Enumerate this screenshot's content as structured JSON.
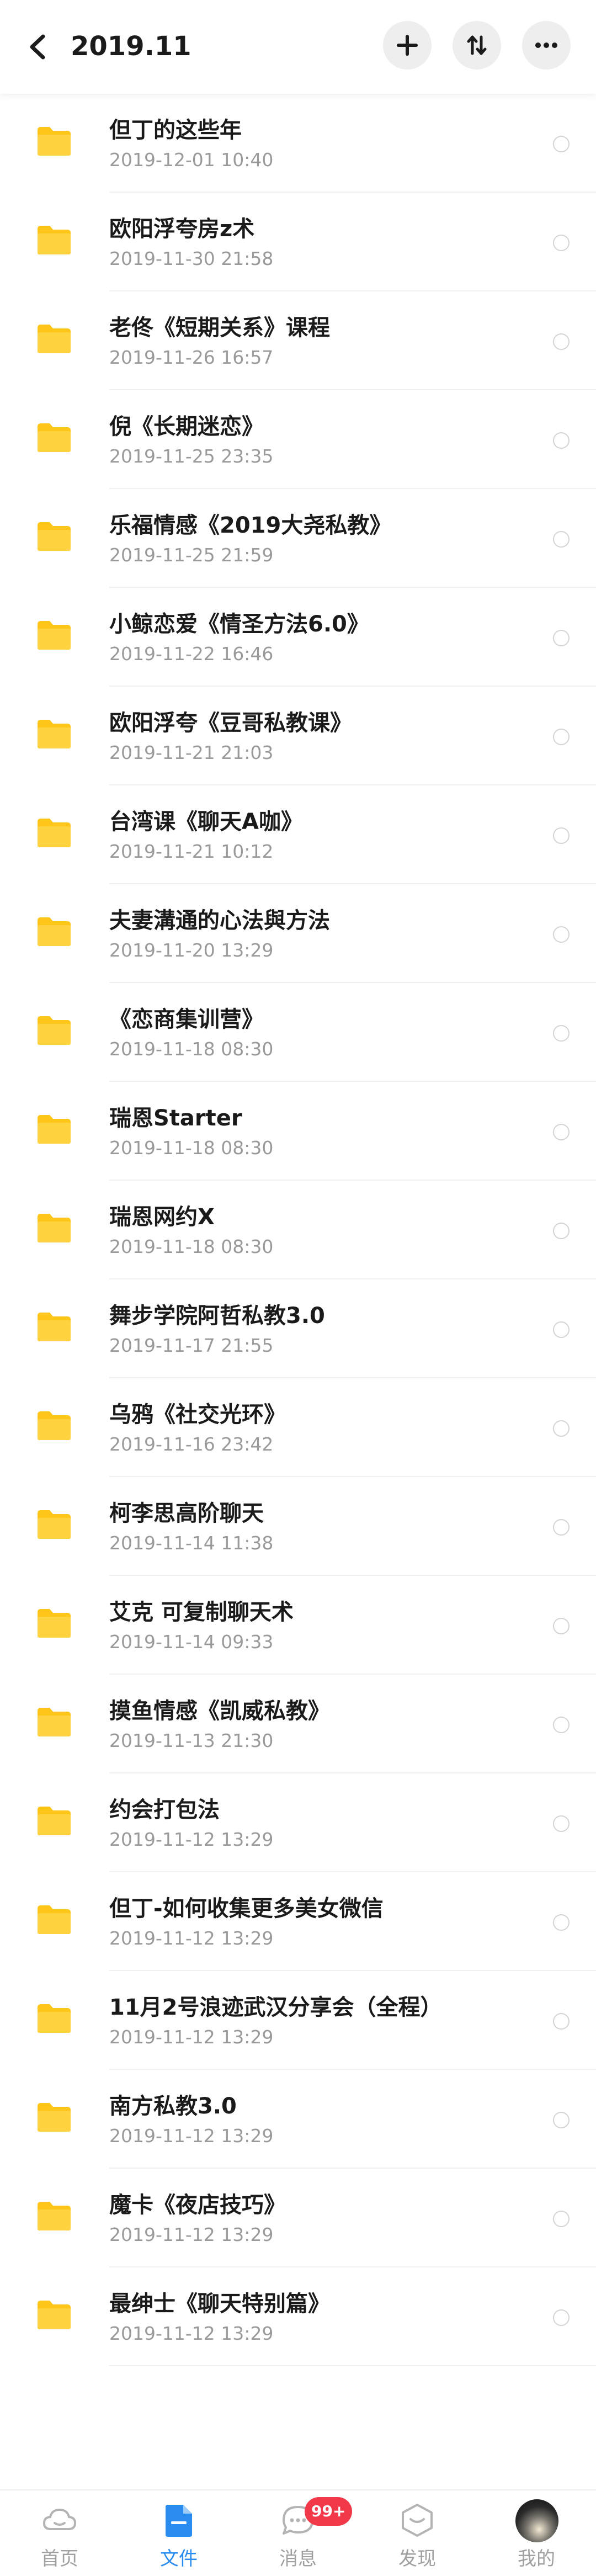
{
  "header": {
    "title": "2019.11",
    "back_icon": "chevron-left-icon",
    "actions": [
      "plus-icon",
      "sort-icon",
      "more-icon"
    ]
  },
  "colors": {
    "folder": "#FFC61A",
    "accent": "#2B8CF0",
    "badge": "#F2394A",
    "date": "#9A9A9A"
  },
  "folders": [
    {
      "name": "但丁的这些年",
      "date": "2019-12-01  10:40"
    },
    {
      "name": "欧阳浮夸房z术",
      "date": "2019-11-30  21:58"
    },
    {
      "name": "老佟《短期关系》课程",
      "date": "2019-11-26  16:57"
    },
    {
      "name": "倪《长期迷恋》",
      "date": "2019-11-25  23:35"
    },
    {
      "name": "乐福情感《2019大尧私教》",
      "date": "2019-11-25  21:59"
    },
    {
      "name": "小鲸恋爱《情圣方法6.0》",
      "date": "2019-11-22  16:46"
    },
    {
      "name": "欧阳浮夸《豆哥私教课》",
      "date": "2019-11-21  21:03"
    },
    {
      "name": "台湾课《聊天A咖》",
      "date": "2019-11-21  10:12"
    },
    {
      "name": "夫妻溝通的心法與方法",
      "date": "2019-11-20  13:29"
    },
    {
      "name": "《恋商集训营》",
      "date": "2019-11-18  08:30"
    },
    {
      "name": "瑞恩Starter",
      "date": "2019-11-18  08:30"
    },
    {
      "name": "瑞恩网约X",
      "date": "2019-11-18  08:30"
    },
    {
      "name": "舞步学院阿哲私教3.0",
      "date": "2019-11-17  21:55"
    },
    {
      "name": "乌鸦《社交光环》",
      "date": "2019-11-16  23:42"
    },
    {
      "name": "柯李思高阶聊天",
      "date": "2019-11-14  11:38"
    },
    {
      "name": "艾克 可复制聊天术",
      "date": "2019-11-14  09:33"
    },
    {
      "name": "摸鱼情感《凯威私教》",
      "date": "2019-11-13  21:30"
    },
    {
      "name": "约会打包法",
      "date": "2019-11-12  13:29"
    },
    {
      "name": "但丁-如何收集更多美女微信",
      "date": "2019-11-12  13:29"
    },
    {
      "name": "11月2号浪迹武汉分享会（全程）",
      "date": "2019-11-12  13:29"
    },
    {
      "name": "南方私教3.0",
      "date": "2019-11-12  13:29"
    },
    {
      "name": "魔卡《夜店技巧》",
      "date": "2019-11-12  13:29"
    },
    {
      "name": "最绅士《聊天特别篇》",
      "date": "2019-11-12  13:29"
    }
  ],
  "tabbar": {
    "tabs": [
      {
        "label": "首页",
        "icon": "cloud-icon",
        "active": false
      },
      {
        "label": "文件",
        "icon": "file-icon",
        "active": true
      },
      {
        "label": "消息",
        "icon": "chat-icon",
        "active": false,
        "badge": "99+"
      },
      {
        "label": "发现",
        "icon": "discover-icon",
        "active": false
      },
      {
        "label": "我的",
        "icon": "avatar",
        "active": false
      }
    ]
  }
}
